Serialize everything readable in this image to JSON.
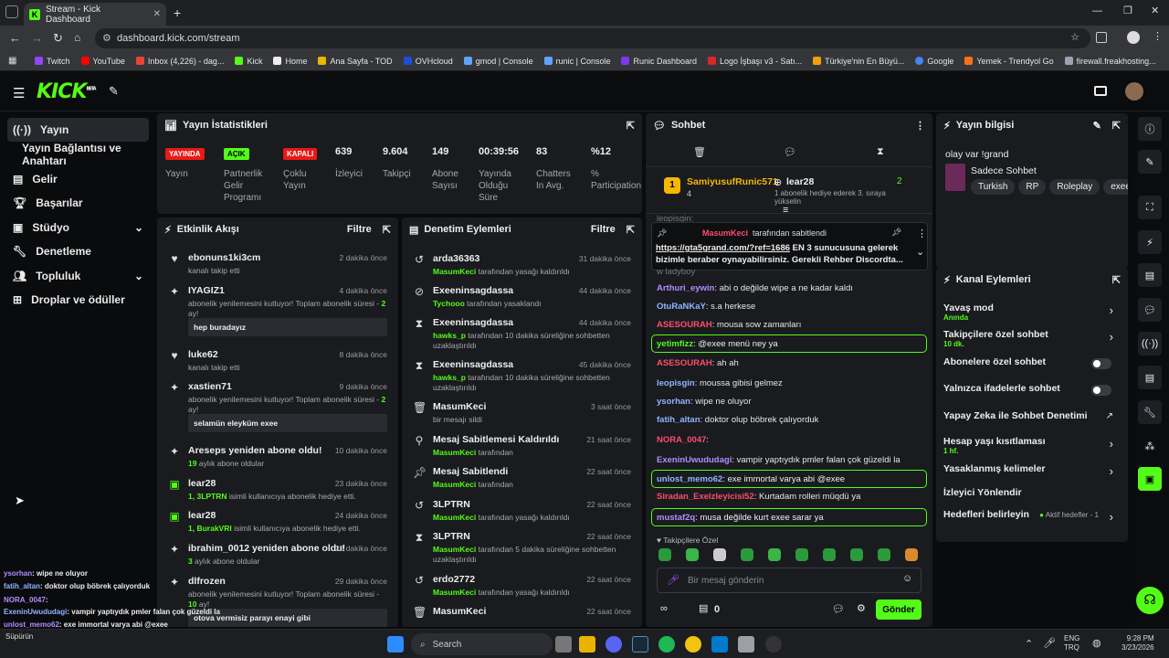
{
  "browser": {
    "tab_title": "Stream - Kick Dashboard",
    "url": "dashboard.kick.com/stream",
    "bookmarks": [
      "Twitch",
      "YouTube",
      "Inbox (4,226) - dag...",
      "Kick",
      "Home",
      "Ana Sayfa - TOD",
      "OVHcloud",
      "gmod | Console",
      "runic | Console",
      "Runic Dashboard",
      "Logo İşbaşı v3 - Satı...",
      "Türkiye'nin En Büyü...",
      "Google",
      "Yemek - Trendyol Go",
      "firewall.freakhosting..."
    ]
  },
  "kick": {
    "logo": "KICK",
    "beta": "BETA"
  },
  "nav": {
    "stream": "Yayın",
    "keys": "Yayın Bağlantısı ve Anahtarı",
    "revenue": "Gelir",
    "achievements": "Başarılar",
    "studio": "Stüdyo",
    "moderation": "Denetleme",
    "community": "Topluluk",
    "drops": "Droplar ve ödüller"
  },
  "stats": {
    "title": "Yayın İstatistikleri",
    "stream_tag": "YAYINDA",
    "stream_label": "Yayın",
    "partner_tag": "AÇIK",
    "partner_label": "Partnerlik Gelir Programı",
    "multi_tag": "KAPALI",
    "multi_label": "Çoklu Yayın",
    "viewers": "639",
    "viewers_label": "İzleyici",
    "followers": "9.604",
    "followers_label": "Takipçi",
    "subs": "149",
    "subs_label": "Abone Sayısı",
    "uptime": "00:39:56",
    "uptime_label": "Yayında Olduğu Süre",
    "chatters": "83",
    "chatters_label": "Chatters In Avg.",
    "participation": "%12",
    "participation_label": "% Participation"
  },
  "activity": {
    "title": "Etkinlik Akışı",
    "filter": "Filtre",
    "items": [
      {
        "name": "ebonuns1ki3cm",
        "time": "2 dakika önce",
        "sub": "kanalı takip etti"
      },
      {
        "name": "IYAGIZ1",
        "time": "4 dakika önce",
        "sub": "abonelik yenilemesini kutluyor! Toplam abonelik süresi -",
        "num": "2",
        "unit": "ay!",
        "quote": "hep buradayız"
      },
      {
        "name": "luke62",
        "time": "8 dakika önce",
        "sub": "kanalı takip etti"
      },
      {
        "name": "xastien71",
        "time": "9 dakika önce",
        "sub": "abonelik yenilemesini kutluyor! Toplam abonelik süresi -",
        "num": "2",
        "unit": "ay!",
        "quote": "selamün eleyküm exee"
      },
      {
        "name": "Areseps yeniden abone oldu!",
        "time": "10 dakika önce",
        "num": "19",
        "sub": "aylık abone oldular"
      },
      {
        "name": "lear28",
        "time": "23 dakika önce",
        "num": "1,",
        "user": "3LPTRN",
        "sub": "isimli kullanıcıya abonelik hediye etti."
      },
      {
        "name": "lear28",
        "time": "24 dakika önce",
        "num": "1,",
        "user": "BurakVRI",
        "sub": "isimli kullanıcıya abonelik hediye etti."
      },
      {
        "name": "ibrahim_0012 yeniden abone oldu!",
        "time": "28 dakika önce",
        "num": "3",
        "sub": "aylık abone oldular"
      },
      {
        "name": "dlfrozen",
        "time": "29 dakika önce",
        "sub": "abonelik yenilemesini kutluyor! Toplam abonelik süresi -",
        "num": "10",
        "unit": "ay!",
        "quote": "otova vermisiz parayı enayi gibi"
      }
    ]
  },
  "modlog": {
    "title": "Denetim Eylemleri",
    "filter": "Filtre",
    "items": [
      {
        "name": "arda36363",
        "time": "31 dakika önce",
        "by": "MasumKeci",
        "sub": "tarafından yasağı kaldırıldı"
      },
      {
        "name": "Exeeninsagdassa",
        "time": "44 dakika önce",
        "by": "Tychooo",
        "sub": "tarafından yasaklandı"
      },
      {
        "name": "Exeeninsagdassa",
        "time": "44 dakika önce",
        "by": "hawks_p",
        "sub": "tarafından 10 dakika süreliğine sohbetten uzaklaştırıldı"
      },
      {
        "name": "Exeeninsagdassa",
        "time": "45 dakika önce",
        "by": "hawks_p",
        "sub": "tarafından 10 dakika süreliğine sohbetten uzaklaştırıldı"
      },
      {
        "name": "MasumKeci",
        "time": "3 saat önce",
        "by": "",
        "sub": "bir mesajı sildi"
      },
      {
        "name": "Mesaj Sabitlemesi Kaldırıldı",
        "time": "21 saat önce",
        "by": "MasumKeci",
        "sub": "tarafından"
      },
      {
        "name": "Mesaj Sabitlendi",
        "time": "22 saat önce",
        "by": "MasumKeci",
        "sub": "tarafından"
      },
      {
        "name": "3LPTRN",
        "time": "22 saat önce",
        "by": "MasumKeci",
        "sub": "tarafından yasağı kaldırıldı"
      },
      {
        "name": "3LPTRN",
        "time": "22 saat önce",
        "by": "MasumKeci",
        "sub": "tarafından 5 dakika süreliğine sohbetten uzaklaştırıldı"
      },
      {
        "name": "erdo2772",
        "time": "22 saat önce",
        "by": "MasumKeci",
        "sub": "tarafından yasağı kaldırıldı"
      },
      {
        "name": "MasumKeci",
        "time": "22 saat önce",
        "by": "",
        "sub": ""
      }
    ]
  },
  "chat": {
    "title": "Sohbet",
    "top_user": "SamiyusufRunic571",
    "top_rank": "1",
    "top_count": "4",
    "gift_user": "lear28",
    "gift_count": "2",
    "gift_text": "1 abonelik hediye ederek 3. sıraya yükselin",
    "pinned_by": "MasumKeci",
    "pinned_by_suffix": "tarafından sabitlendi",
    "pinned_link": "https://gta5grand.com/?ref=1686",
    "pinned_text": "EN 3 sunucusuna gelerek bizimle beraber oynayabilirsiniz. Gerekli Rehber Discordta...",
    "partial_top": "leopisgin:",
    "partial_top2": "w ladyboy",
    "messages": [
      {
        "u": "Arthuri_eywin",
        "c": "#b48cff",
        "m": "abi o değilde wipe a ne kadar kaldı"
      },
      {
        "u": "OtuRaNKaY",
        "c": "#8fb6ff",
        "m": "s.a herkese"
      },
      {
        "u": "ASESOURAH",
        "c": "#ff4d6d",
        "m": "mousa sow zamanları"
      },
      {
        "u": "yetimfizz",
        "c": "#53fc18",
        "m": "@exee menü ney ya",
        "hl": true
      },
      {
        "u": "ASESOURAH",
        "c": "#ff4d6d",
        "m": "ah ah"
      },
      {
        "u": "leopisgin",
        "c": "#8fb6ff",
        "m": "moussa gibisi gelmez"
      },
      {
        "u": "ysorhan",
        "c": "#8fb6ff",
        "m": "wipe ne oluyor"
      },
      {
        "u": "fatih_altan",
        "c": "#8fb6ff",
        "m": "doktor olup böbrek çalıyorduk"
      },
      {
        "u": "NORA_0047",
        "c": "#ff4d6d",
        "m": ""
      },
      {
        "u": "ExeninUwududagi",
        "c": "#b48cff",
        "m": "vampir yaptıydık pmler falan çok güzeldi la"
      },
      {
        "u": "unlost_memo62",
        "c": "#8fb6ff",
        "m": "exe immortal varya abi @exee",
        "hl": true
      },
      {
        "u": "Siradan_Exelzleyicisi52",
        "c": "#ff4d6d",
        "m": "Kurtadam rolleri müqdü ya"
      },
      {
        "u": "mustaf2q",
        "c": "#b48cff",
        "m": "musa değilde kurt exee sarar ya",
        "hl": true
      }
    ],
    "follower_label": "Takipçilere Özel",
    "input_placeholder": "Bir mesaj gönderin",
    "points": "0",
    "send": "Gönder"
  },
  "info": {
    "title": "Yayın bilgisi",
    "stream_title": "olay var !grand",
    "category": "Sadece Sohbet",
    "tags": [
      "Turkish",
      "RP",
      "Roleplay",
      "exee"
    ]
  },
  "channel": {
    "title": "Kanal Eylemleri",
    "slow": "Yavaş mod",
    "slow_sub": "Anında",
    "followers": "Takipçilere özel sohbet",
    "followers_sub": "10 dk.",
    "subs": "Abonelere özel sohbet",
    "emotes": "Yalnızca ifadelerle sohbet",
    "ai": "Yapay Zeka ile Sohbet Denetimi",
    "age": "Hesap yaşı kısıtlaması",
    "age_sub": "1 hf.",
    "banned": "Yasaklanmış kelimeler",
    "redirect": "İzleyici Yönlendir",
    "goals": "Hedefleri belirleyin",
    "goals_sub": "Aktif hedefler - 1"
  },
  "overlay": [
    {
      "u": "ysorhan",
      "m": ": wipe ne oluyor"
    },
    {
      "u": "fatih_altan",
      "m": ": doktor olup böbrek çalıyorduk"
    },
    {
      "u": "NORA_0047",
      "m": ":"
    },
    {
      "u": "ExeninUwududagi",
      "m": ": vampir yaptıydık pmler falan çok güzeldi la"
    },
    {
      "u": "unlost_memo62",
      "m": ": exe immortal varya abi @exee"
    },
    {
      "u": "Siradan_Exelzleyicisi52",
      "m": ": Kurtadam rolleri müqdü ya"
    },
    {
      "u": "mustaf2q",
      "m": ": musa değilde kurt exee sarar ya"
    }
  ],
  "taskbar": {
    "search": "Search",
    "lang1": "ENG",
    "lang2": "TRQ",
    "time": "9:28 PM",
    "date": "3/23/2026",
    "ms_text": "Süpürün"
  }
}
